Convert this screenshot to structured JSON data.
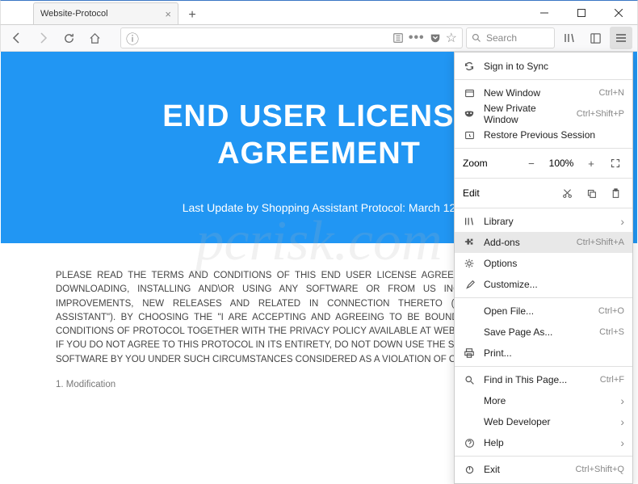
{
  "window": {
    "tab_title": "Website-Protocol"
  },
  "toolbar": {
    "search_placeholder": "Search"
  },
  "page": {
    "heading_l1": "END USER LICENSE",
    "heading_l2": "AGREEMENT",
    "subtitle": "Last Update by Shopping Assistant Protocol: March 12",
    "body": "PLEASE READ THE TERMS AND CONDITIONS OF THIS END USER LICENSE AGREEMENT CAREFULLY BEFORE DOWNLOADING, INSTALLING AND\\OR USING ANY SOFTWARE OR FROM US INCLUDING ANY REVISIONS, IMPROVEMENTS, NEW RELEASES AND RELATED IN CONNECTION THERETO (THE \"AMAZON SHOPPING ASSISTANT\"). BY CHOOSING THE \"I ARE ACCEPTING AND AGREEING TO BE BOUND BY ALL THE TERMS AND CONDITIONS OF PROTOCOL TOGETHER WITH THE PRIVACY POLICY AVAILABLE AT WEB SITE, GOVERN SOFTWARE. IF YOU DO NOT AGREE TO THIS PROTOCOL IN ITS ENTIRETY, DO NOT DOWN USE THE SOFTWARE. ANY USE OF THE SOFTWARE BY YOU UNDER SUCH CIRCUMSTANCES CONSIDERED AS A VIOLATION OF OUR LEGAL RIGHTS.",
    "section1": "1. Modification"
  },
  "watermark": "pcrisk.com",
  "menu": {
    "sign_in": "Sign in to Sync",
    "new_window": "New Window",
    "new_window_sc": "Ctrl+N",
    "new_private": "New Private Window",
    "new_private_sc": "Ctrl+Shift+P",
    "restore": "Restore Previous Session",
    "zoom_label": "Zoom",
    "zoom_value": "100%",
    "edit_label": "Edit",
    "library": "Library",
    "addons": "Add-ons",
    "addons_sc": "Ctrl+Shift+A",
    "options": "Options",
    "customize": "Customize...",
    "open_file": "Open File...",
    "open_file_sc": "Ctrl+O",
    "save_page": "Save Page As...",
    "save_page_sc": "Ctrl+S",
    "print": "Print...",
    "find": "Find in This Page...",
    "find_sc": "Ctrl+F",
    "more": "More",
    "webdev": "Web Developer",
    "help": "Help",
    "exit": "Exit",
    "exit_sc": "Ctrl+Shift+Q"
  }
}
